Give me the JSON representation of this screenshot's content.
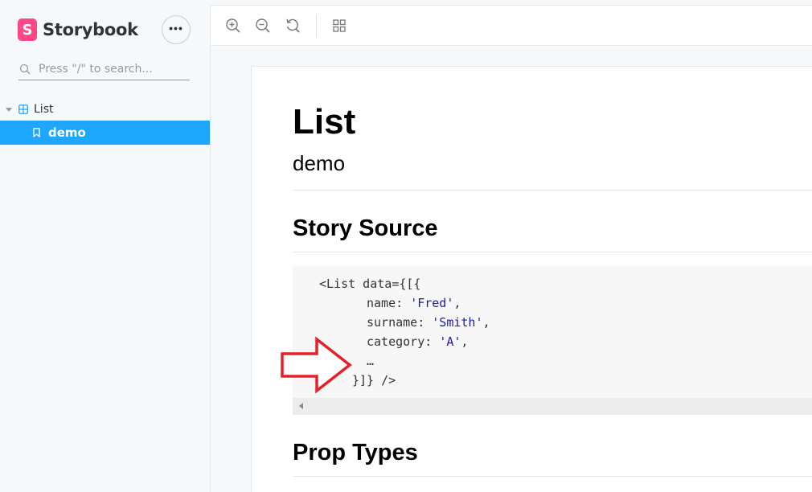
{
  "app": {
    "brand_logo_letter": "S",
    "brand_name": "Storybook",
    "menu_button_label": "•••",
    "accent_color": "#ff4785",
    "selection_color": "#1ea7fd"
  },
  "sidebar": {
    "search": {
      "placeholder": "Press \"/\" to search..."
    },
    "tree": {
      "group_label": "List",
      "items": [
        {
          "label": "demo",
          "selected": true
        }
      ]
    }
  },
  "toolbar": {
    "icons": [
      "zoom-in-icon",
      "zoom-out-icon",
      "zoom-reset-icon",
      "grid-icon"
    ]
  },
  "docs": {
    "title": "List",
    "subtitle": "demo",
    "story_source_heading": "Story Source",
    "prop_types_heading": "Prop Types",
    "code": {
      "line1": "<List data={[{",
      "name_key": "name: ",
      "name_value": "'Fred'",
      "surname_key": "surname: ",
      "surname_value": "'Smith'",
      "category_key": "category: ",
      "category_value": "'A'",
      "comma": ",",
      "ellipsis": "…",
      "line_last": "}]} />"
    }
  }
}
